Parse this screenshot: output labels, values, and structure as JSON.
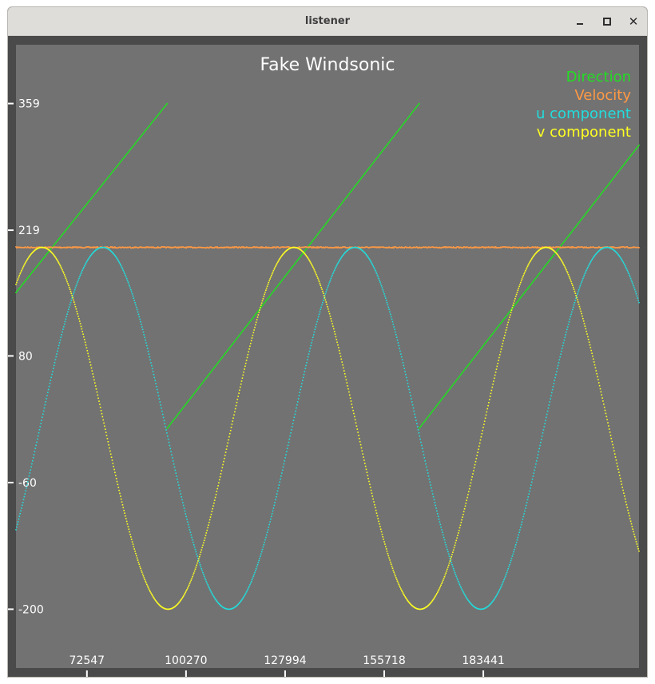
{
  "window": {
    "title": "listener",
    "buttons": {
      "minimize": "minimize-icon",
      "maximize": "maximize-icon",
      "close": "close-icon"
    }
  },
  "colors": {
    "background": "#4a4a4a",
    "plot_area": "#727272",
    "direction": "#22dd22",
    "velocity": "#ff9944",
    "u_component": "#22dddd",
    "v_component": "#ffff22"
  },
  "chart_data": {
    "type": "scatter",
    "title": "Fake Windsonic",
    "xlabel": "",
    "ylabel": "",
    "xlim": [
      52700,
      227000
    ],
    "ylim": [
      -265,
      424
    ],
    "grid": false,
    "legend_position": "top-right",
    "x_ticks": [
      72547,
      100270,
      127994,
      155718,
      183441
    ],
    "x_tick_labels": [
      "72547",
      "100270",
      "127994",
      "155718",
      "183441"
    ],
    "y_ticks": [
      359,
      219,
      80,
      -60,
      -200
    ],
    "y_tick_labels": [
      "359",
      "219",
      "80",
      "-60",
      "-200"
    ],
    "series": [
      {
        "name": "Direction",
        "color": "#22dd22",
        "kind": "sawtooth",
        "segments": [
          {
            "x": [
              52700,
              95000
            ],
            "y": [
              150,
              359
            ]
          },
          {
            "x": [
              95000,
              165500
            ],
            "y": [
              0,
              359
            ]
          },
          {
            "x": [
              165500,
              227000
            ],
            "y": [
              0,
              313
            ]
          }
        ]
      },
      {
        "name": "Velocity",
        "color": "#ff9944",
        "kind": "constant",
        "value": 200
      },
      {
        "name": "u component",
        "color": "#22dddd",
        "kind": "sine",
        "amplitude": 200,
        "period": 70500,
        "peak_x": [
          77000,
          147500,
          218000
        ]
      },
      {
        "name": "v component",
        "color": "#ffff22",
        "kind": "sine",
        "amplitude": 200,
        "period": 70500,
        "peak_x": [
          60000,
          130500,
          201000
        ]
      }
    ]
  }
}
